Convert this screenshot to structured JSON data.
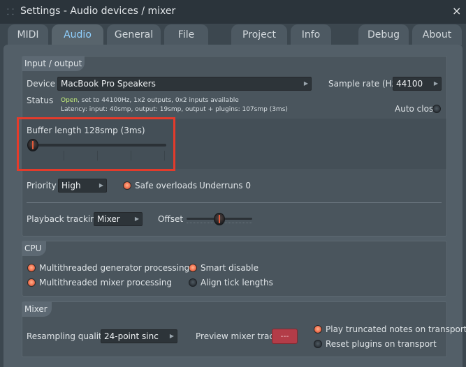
{
  "window": {
    "title": "Settings - Audio devices / mixer",
    "close": "×"
  },
  "tabs": [
    "MIDI",
    "Audio",
    "General",
    "File",
    "Project",
    "Info",
    "Debug",
    "About"
  ],
  "active_tab": "Audio",
  "io": {
    "header": "Input / output",
    "device_label": "Device",
    "device_value": "MacBook Pro Speakers",
    "sample_rate_label": "Sample rate (Hz)",
    "sample_rate_value": "44100",
    "status_label": "Status",
    "status_open": "Open",
    "status_line1_rest": ", set to 44100Hz, 1x2 outputs, 0x2 inputs available",
    "status_line2": "Latency: input: 40smp, output: 19smp, output + plugins: 107smp (3ms)",
    "auto_close_label": "Auto close",
    "auto_close_checked": false,
    "buffer_label": "Buffer length 128smp (3ms)",
    "buffer_level": 0.0,
    "priority_label": "Priority",
    "priority_value": "High",
    "safe_overloads_label": "Safe overloads",
    "safe_overloads_checked": true,
    "underruns": "Underruns 0",
    "playback_tracking_label": "Playback tracking",
    "playback_tracking_value": "Mixer",
    "offset_label": "Offset",
    "offset_level": 0.5
  },
  "cpu": {
    "header": "CPU",
    "options": [
      {
        "label": "Multithreaded generator processing",
        "checked": true
      },
      {
        "label": "Multithreaded mixer processing",
        "checked": true
      },
      {
        "label": "Smart disable",
        "checked": true
      },
      {
        "label": "Align tick lengths",
        "checked": false
      }
    ]
  },
  "mixer": {
    "header": "Mixer",
    "resampling_label": "Resampling quality",
    "resampling_value": "24-point sinc",
    "preview_label": "Preview mixer track",
    "preview_value": "---",
    "options": [
      {
        "label": "Play truncated notes on transport",
        "checked": true
      },
      {
        "label": "Reset plugins on transport",
        "checked": false
      }
    ]
  },
  "colors": {
    "accent": "#8fd0ff",
    "radio_on": "#f07150",
    "status_open": "#c4f07a",
    "highlight_box": "#e43b2b",
    "preview_button": "#b33c48"
  }
}
